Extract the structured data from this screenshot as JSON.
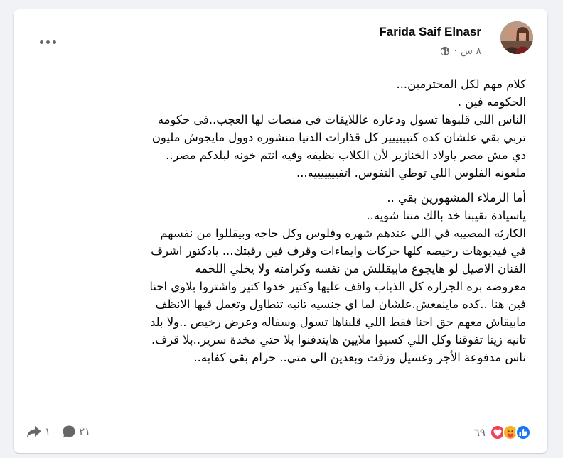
{
  "post": {
    "author": "Farida Saif Elnasr",
    "time": "٨ س",
    "separator": "·",
    "lines": [
      [
        "كلام مهم لكل المحترمين...",
        "الحكومه فين .",
        "الناس اللي قلبوها تسول ودعاره عاللايفات في منصات لها العجب..في حكومه",
        "تربي بقي علشان كده كتيييييير كل قذارات الدنيا منشوره دوول مايجوش  مليون",
        "دي مش مصر ياولاد الخنازير لأن الكلاب نظيفه وفيه انتم خونه لبلدكم مصر..",
        "ملعونه الفلوس اللي توطي النفوس. اتفيييييييه..."
      ],
      [
        "أما الزملاء المشهورين بقي ..",
        "ياسيادة نقيبنا خد بالك مننا شويه..",
        "الكارثه المصيبه في اللي عندهم شهره وفلوس وكل حاجه وبيقللوا من نفسهم",
        "في فيديوهات رخيصه كلها حركات وايماءات وقرف فين رقبتك... يادكتور اشرف",
        "الفنان الاصيل لو هايجوع مابيقللش من نفسه وكرامته ولا يخلي اللحمه",
        "معروضه بره الجزاره كل الذباب واقف عليها وكتير خدوا كتير واشتروا بلاوي احنا",
        "فين هنا ..كده ماينفعش.علشان لما اي جنسيه تانيه تتطاول وتعمل فيها الانظف",
        "مابيقاش معهم حق احنا فقط اللي قلبناها تسول وسفاله وعرض رخيص ..ولا بلد",
        "تانيه زينا تفوقنا وكل اللي كسبوا ملايين هايندفنوا بلا حتي مخدة سرير..بلا قرف.",
        "ناس مدفوعة الأجر وغسيل وزفت وبعدين الي متي.. حرام بقي كفايه.."
      ]
    ]
  },
  "footer": {
    "reaction_count": "٦٩",
    "comment_count": "٢١",
    "share_count": "١"
  },
  "colors": {
    "like": "#1877f2",
    "love": "#f33e58",
    "care": "#f7b125",
    "meta_gray": "#65676b"
  },
  "icons": [
    "more-icon",
    "globe-icon",
    "like-reaction-icon",
    "care-reaction-icon",
    "love-reaction-icon",
    "comment-icon",
    "share-icon"
  ]
}
